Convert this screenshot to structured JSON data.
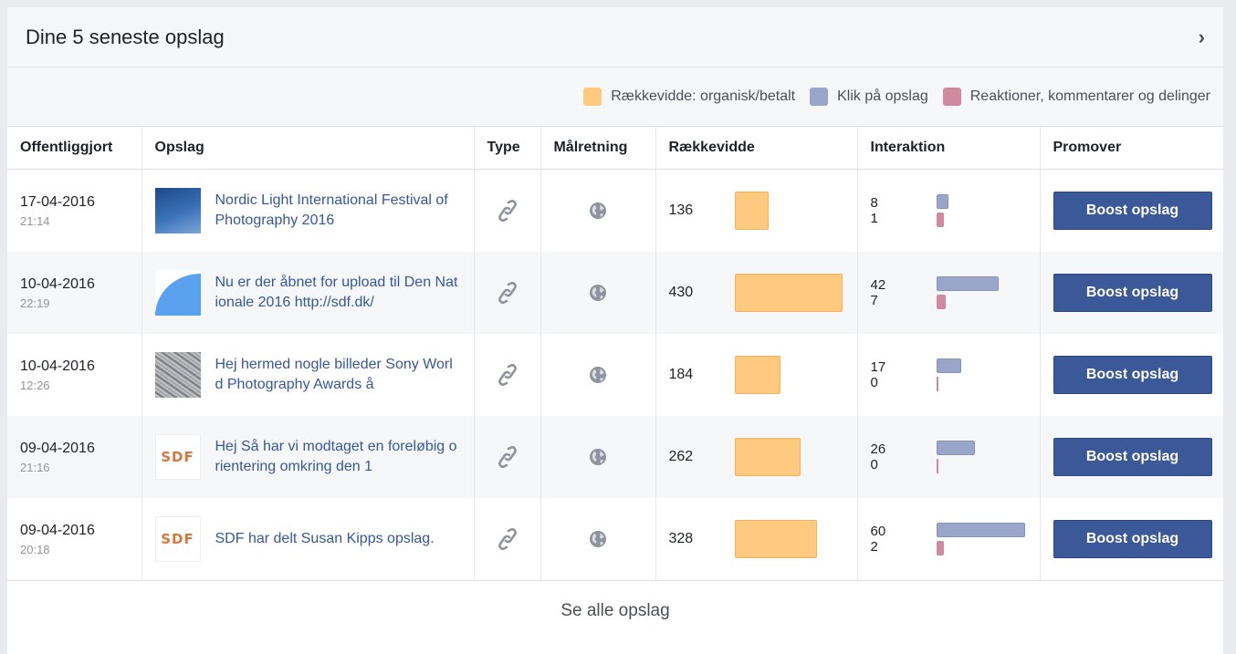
{
  "header": {
    "title": "Dine 5 seneste opslag",
    "chevron": "›"
  },
  "legend": [
    {
      "label": "Rækkevidde: organisk/betalt",
      "color": "#ffca80"
    },
    {
      "label": "Klik på opslag",
      "color": "#9aa6c9"
    },
    {
      "label": "Reaktioner, kommentarer og delinger",
      "color": "#d08aa0"
    }
  ],
  "columns": [
    "Offentliggjort",
    "Opslag",
    "Type",
    "Målretning",
    "Rækkevidde",
    "Interaktion",
    "Promover"
  ],
  "rows": [
    {
      "date": "17-04-2016",
      "time": "21:14",
      "thumb": "sky",
      "text": "Nordic Light International Festival of Photography 2016",
      "reach": "136",
      "clicks": "8",
      "reactions": "1",
      "button": "Boost opslag"
    },
    {
      "date": "10-04-2016",
      "time": "22:19",
      "thumb": "blue",
      "text": "Nu er der åbnet for upload til Den Nationale 2016 http://sdf.dk/",
      "reach": "430",
      "clicks": "42",
      "reactions": "7",
      "button": "Boost opslag"
    },
    {
      "date": "10-04-2016",
      "time": "12:26",
      "thumb": "gray",
      "text": "Hej hermed nogle billeder Sony World Photography Awards å",
      "reach": "184",
      "clicks": "17",
      "reactions": "0",
      "button": "Boost opslag"
    },
    {
      "date": "09-04-2016",
      "time": "21:16",
      "thumb": "logo",
      "logo": "SDF",
      "text": "Hej Så har vi modtaget en foreløbig orientering omkring den 1",
      "reach": "262",
      "clicks": "26",
      "reactions": "0",
      "button": "Boost opslag"
    },
    {
      "date": "09-04-2016",
      "time": "20:18",
      "thumb": "logo",
      "logo": "SDF",
      "text": "SDF har delt Susan Kipps opslag.",
      "reach": "328",
      "clicks": "60",
      "reactions": "2",
      "button": "Boost opslag"
    }
  ],
  "icons": {
    "type": "link-icon",
    "targeting": "globe-icon"
  },
  "footer": {
    "link": "Se alle opslag"
  }
}
